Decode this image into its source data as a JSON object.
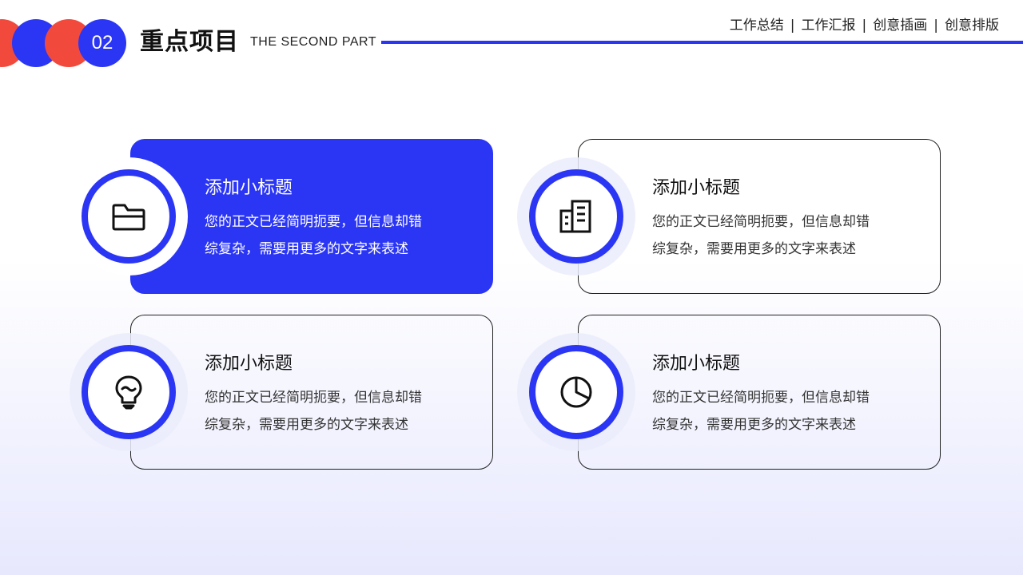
{
  "header": {
    "section_number": "02",
    "title": "重点项目",
    "subtitle": "THE SECOND PART",
    "nav_items": [
      "工作总结",
      "工作汇报",
      "创意插画",
      "创意排版"
    ],
    "nav_separator": "|"
  },
  "colors": {
    "accent_blue": "#2b36f5",
    "accent_red": "#f14a3d"
  },
  "cards": [
    {
      "title": "添加小标题",
      "body_line1": "您的正文已经简明扼要，但信息却错",
      "body_line2": "综复杂，需要用更多的文字来表述",
      "icon": "folder-icon",
      "active": true
    },
    {
      "title": "添加小标题",
      "body_line1": "您的正文已经简明扼要，但信息却错",
      "body_line2": "综复杂，需要用更多的文字来表述",
      "icon": "building-icon",
      "active": false
    },
    {
      "title": "添加小标题",
      "body_line1": "您的正文已经简明扼要，但信息却错",
      "body_line2": "综复杂，需要用更多的文字来表述",
      "icon": "lightbulb-icon",
      "active": false
    },
    {
      "title": "添加小标题",
      "body_line1": "您的正文已经简明扼要，但信息却错",
      "body_line2": "综复杂，需要用更多的文字来表述",
      "icon": "pie-chart-icon",
      "active": false
    }
  ]
}
